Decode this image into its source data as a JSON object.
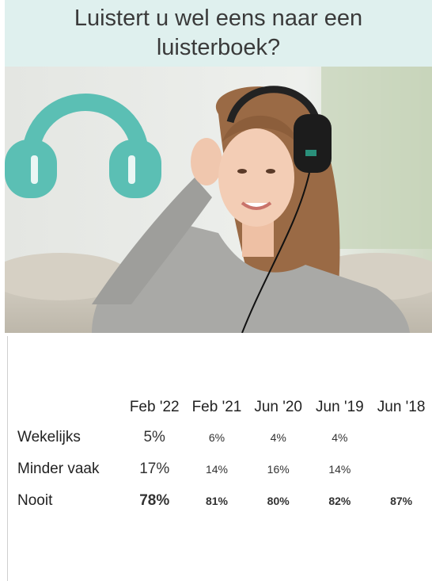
{
  "title": "Luistert u wel eens naar een luisterboek?",
  "image": {
    "description_icon": "headphones-icon",
    "accent_color": "#5bbfb4"
  },
  "chart_data": {
    "type": "table",
    "columns": [
      "Feb '22",
      "Feb '21",
      "Jun '20",
      "Jun '19",
      "Jun '18"
    ],
    "rows": [
      {
        "label": "Wekelijks",
        "values": [
          "5%",
          "6%",
          "4%",
          "4%",
          ""
        ]
      },
      {
        "label": "Minder vaak",
        "values": [
          "17%",
          "14%",
          "16%",
          "14%",
          ""
        ]
      },
      {
        "label": "Nooit",
        "values": [
          "78%",
          "81%",
          "80%",
          "82%",
          "87%"
        ]
      }
    ]
  }
}
